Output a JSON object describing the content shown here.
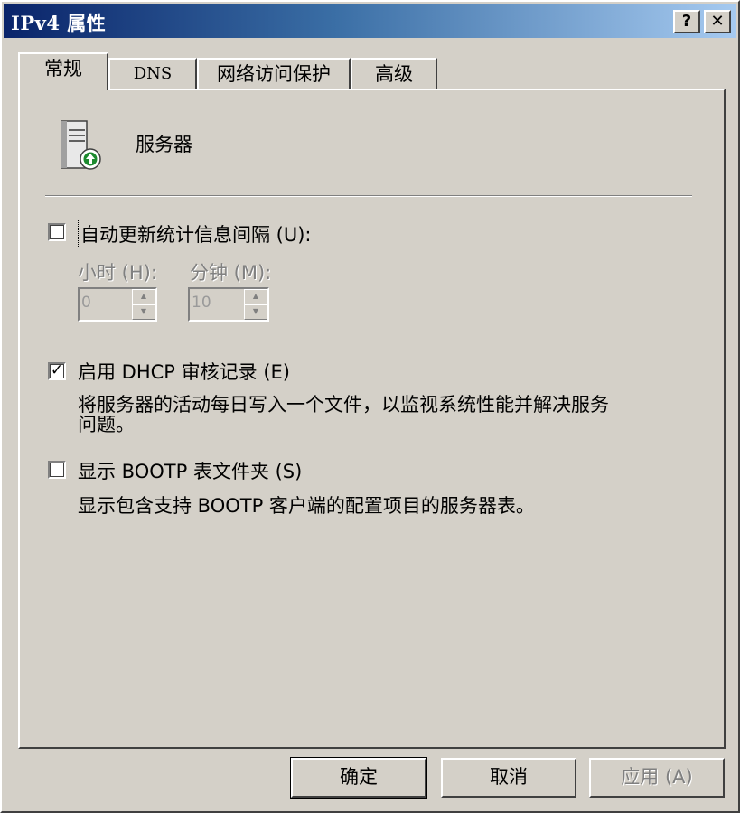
{
  "window": {
    "title": "IPv4 属性",
    "help_label": "?",
    "close_label": "✕"
  },
  "tabs": [
    {
      "label": "常规",
      "active": true
    },
    {
      "label": "DNS",
      "active": false
    },
    {
      "label": "网络访问保护",
      "active": false
    },
    {
      "label": "高级",
      "active": false
    }
  ],
  "general": {
    "server_label": "服务器",
    "server_icon": "server-icon",
    "auto_update": {
      "label": "自动更新统计信息间隔 (U):",
      "checked": false,
      "hours_label": "小时 (H):",
      "hours_value": "0",
      "minutes_label": "分钟 (M):",
      "minutes_value": "10"
    },
    "dhcp_audit": {
      "label": "启用 DHCP 审核记录 (E)",
      "checked": true,
      "description_line1": "将服务器的活动每日写入一个文件，以监视系统性能并解决服务",
      "description_line2": "问题。"
    },
    "bootp": {
      "label": "显示 BOOTP 表文件夹 (S)",
      "checked": false,
      "description": "显示包含支持 BOOTP 客户端的配置项目的服务器表。"
    }
  },
  "buttons": {
    "ok": "确定",
    "cancel": "取消",
    "apply": "应用 (A)"
  },
  "colors": {
    "title_gradient_start": "#0a246a",
    "title_gradient_end": "#a6caf0",
    "face": "#d4d0c8"
  }
}
